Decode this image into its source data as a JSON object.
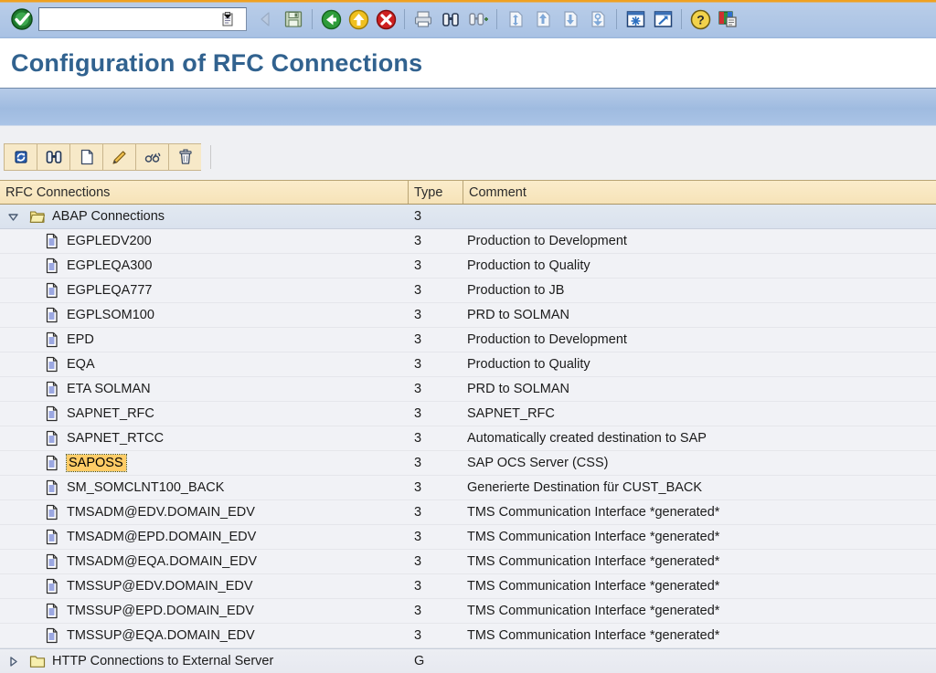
{
  "window": {
    "accent_orange": "#f0a020",
    "toolbar_blue": "#a9c2e4",
    "title_color": "#31628f"
  },
  "system_toolbar": {
    "ok_button": "enter-ok",
    "command_field": {
      "value": "",
      "placeholder": ""
    },
    "command_field_dropdown": "clipboard-dropdown-icon",
    "buttons": [
      {
        "name": "back-button",
        "icon": "left-arrow-icon",
        "enabled": false
      },
      {
        "name": "save-button",
        "icon": "floppy-save-icon",
        "enabled": true
      },
      {
        "name": "back-green-button",
        "icon": "green-back-arrow-icon",
        "enabled": true
      },
      {
        "name": "exit-button",
        "icon": "yellow-up-arrow-icon",
        "enabled": true
      },
      {
        "name": "cancel-button",
        "icon": "red-cancel-icon",
        "enabled": true
      },
      {
        "name": "print-button",
        "icon": "printer-icon",
        "enabled": true
      },
      {
        "name": "find-button",
        "icon": "binoculars-icon",
        "enabled": true
      },
      {
        "name": "find-next-button",
        "icon": "binoculars-plus-icon",
        "enabled": true
      },
      {
        "name": "first-page-button",
        "icon": "first-page-icon",
        "enabled": true
      },
      {
        "name": "previous-page-button",
        "icon": "previous-page-icon",
        "enabled": true
      },
      {
        "name": "next-page-button",
        "icon": "next-page-icon",
        "enabled": true
      },
      {
        "name": "last-page-button",
        "icon": "last-page-icon",
        "enabled": true
      },
      {
        "name": "create-session-button",
        "icon": "new-session-icon",
        "enabled": true
      },
      {
        "name": "create-shortcut-button",
        "icon": "shortcut-arrow-icon",
        "enabled": true
      },
      {
        "name": "help-button",
        "icon": "question-help-icon",
        "enabled": true
      },
      {
        "name": "layout-menu-button",
        "icon": "customize-layout-icon",
        "enabled": true
      }
    ]
  },
  "header": {
    "title": "Configuration of RFC Connections"
  },
  "app_toolbar": {
    "buttons": [
      {
        "name": "refresh-button",
        "icon": "refresh-icon",
        "label": "Refresh"
      },
      {
        "name": "find-button",
        "icon": "binoculars-icon",
        "label": "Find"
      },
      {
        "name": "create-button",
        "icon": "blank-page-icon",
        "label": "Create"
      },
      {
        "name": "change-button",
        "icon": "pencil-icon",
        "label": "Change"
      },
      {
        "name": "copy-button",
        "icon": "glasses-copy-icon",
        "label": "Copy"
      },
      {
        "name": "delete-button",
        "icon": "trash-icon",
        "label": "Delete"
      }
    ]
  },
  "table": {
    "columns": [
      {
        "key": "name",
        "label": "RFC Connections"
      },
      {
        "key": "type",
        "label": "Type"
      },
      {
        "key": "comment",
        "label": "Comment"
      }
    ],
    "rows": [
      {
        "kind": "root",
        "expander": "expanded",
        "icon": "open-folder-icon",
        "name": "ABAP Connections",
        "type": "3",
        "comment": "",
        "selected": false
      },
      {
        "kind": "leaf",
        "expander": "none",
        "icon": "document-icon",
        "name": "EGPLEDV200",
        "type": "3",
        "comment": "Production to Development",
        "selected": false
      },
      {
        "kind": "leaf",
        "expander": "none",
        "icon": "document-icon",
        "name": "EGPLEQA300",
        "type": "3",
        "comment": "Production to Quality",
        "selected": false
      },
      {
        "kind": "leaf",
        "expander": "none",
        "icon": "document-icon",
        "name": "EGPLEQA777",
        "type": "3",
        "comment": "Production to JB",
        "selected": false
      },
      {
        "kind": "leaf",
        "expander": "none",
        "icon": "document-icon",
        "name": "EGPLSOM100",
        "type": "3",
        "comment": "PRD to SOLMAN",
        "selected": false
      },
      {
        "kind": "leaf",
        "expander": "none",
        "icon": "document-icon",
        "name": "EPD",
        "type": "3",
        "comment": "Production to Development",
        "selected": false
      },
      {
        "kind": "leaf",
        "expander": "none",
        "icon": "document-icon",
        "name": "EQA",
        "type": "3",
        "comment": "Production to Quality",
        "selected": false
      },
      {
        "kind": "leaf",
        "expander": "none",
        "icon": "document-icon",
        "name": "ETA SOLMAN",
        "type": "3",
        "comment": "PRD to SOLMAN",
        "selected": false
      },
      {
        "kind": "leaf",
        "expander": "none",
        "icon": "document-icon",
        "name": "SAPNET_RFC",
        "type": "3",
        "comment": "SAPNET_RFC",
        "selected": false
      },
      {
        "kind": "leaf",
        "expander": "none",
        "icon": "document-icon",
        "name": "SAPNET_RTCC",
        "type": "3",
        "comment": "Automatically created destination to SAP",
        "selected": false
      },
      {
        "kind": "leaf",
        "expander": "none",
        "icon": "document-icon",
        "name": "SAPOSS",
        "type": "3",
        "comment": "SAP OCS Server (CSS)",
        "selected": true
      },
      {
        "kind": "leaf",
        "expander": "none",
        "icon": "document-icon",
        "name": "SM_SOMCLNT100_BACK",
        "type": "3",
        "comment": "Generierte Destination für CUST_BACK",
        "selected": false
      },
      {
        "kind": "leaf",
        "expander": "none",
        "icon": "document-icon",
        "name": "TMSADM@EDV.DOMAIN_EDV",
        "type": "3",
        "comment": "TMS Communication Interface  *generated*",
        "selected": false
      },
      {
        "kind": "leaf",
        "expander": "none",
        "icon": "document-icon",
        "name": "TMSADM@EPD.DOMAIN_EDV",
        "type": "3",
        "comment": "TMS Communication Interface  *generated*",
        "selected": false
      },
      {
        "kind": "leaf",
        "expander": "none",
        "icon": "document-icon",
        "name": "TMSADM@EQA.DOMAIN_EDV",
        "type": "3",
        "comment": "TMS Communication Interface  *generated*",
        "selected": false
      },
      {
        "kind": "leaf",
        "expander": "none",
        "icon": "document-icon",
        "name": "TMSSUP@EDV.DOMAIN_EDV",
        "type": "3",
        "comment": "TMS Communication Interface  *generated*",
        "selected": false
      },
      {
        "kind": "leaf",
        "expander": "none",
        "icon": "document-icon",
        "name": "TMSSUP@EPD.DOMAIN_EDV",
        "type": "3",
        "comment": "TMS Communication Interface  *generated*",
        "selected": false
      },
      {
        "kind": "leaf",
        "expander": "none",
        "icon": "document-icon",
        "name": "TMSSUP@EQA.DOMAIN_EDV",
        "type": "3",
        "comment": "TMS Communication Interface  *generated*",
        "selected": false
      },
      {
        "kind": "folder",
        "expander": "collapsed",
        "icon": "closed-folder-icon",
        "name": "HTTP Connections to External Server",
        "type": "G",
        "comment": "",
        "selected": false
      }
    ]
  }
}
